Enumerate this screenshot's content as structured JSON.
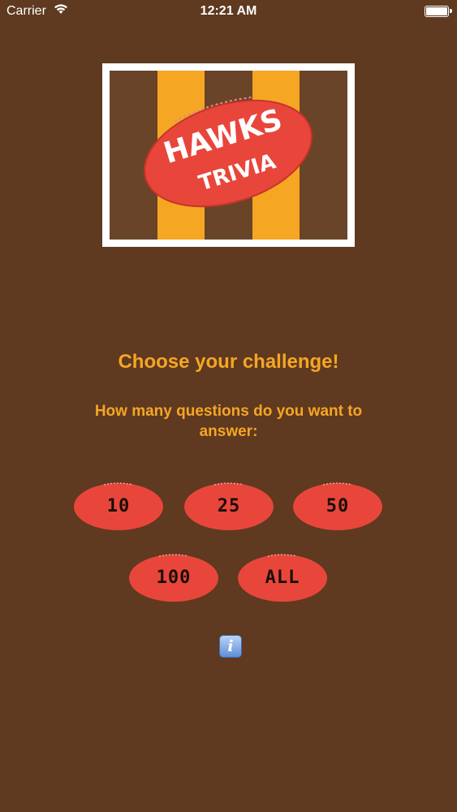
{
  "status_bar": {
    "carrier": "Carrier",
    "time": "12:21 AM"
  },
  "logo": {
    "line1": "HAWKS",
    "line2": "TRIVIA",
    "colors": {
      "brown": "#6a4428",
      "gold": "#f5a623",
      "ball": "#e8463b"
    }
  },
  "heading": "Choose your challenge!",
  "subheading": "How many questions do you want to answer:",
  "options": [
    {
      "label": "10"
    },
    {
      "label": "25"
    },
    {
      "label": "50"
    },
    {
      "label": "100"
    },
    {
      "label": "ALL"
    }
  ],
  "info_icon": "info-icon",
  "colors": {
    "background": "#5f3920",
    "accent": "#f5a623",
    "ball_red": "#e8463b"
  }
}
